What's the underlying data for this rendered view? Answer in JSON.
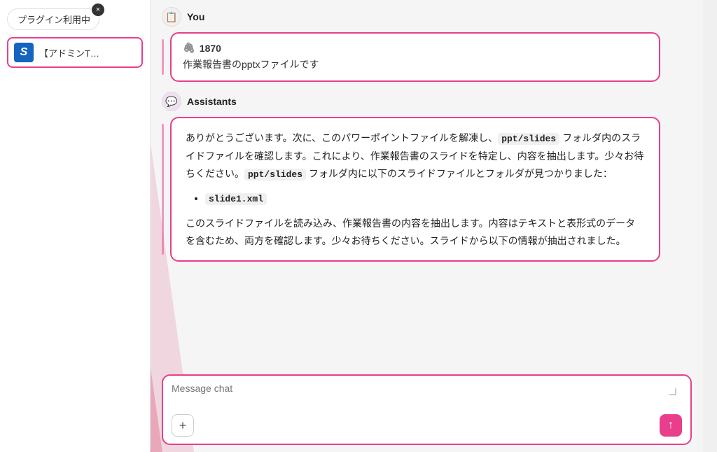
{
  "sidebar": {
    "plugin_label": "プラグイン利用中",
    "close_icon": "×",
    "item": {
      "icon_letter": "S",
      "label": "【アドミンT…"
    }
  },
  "you_section": {
    "sender": "You",
    "avatar_icon": "📋",
    "attachment_number": "1870",
    "clip_icon": "🖇",
    "message": "作業報告書のpptxファイルです"
  },
  "assistant_section": {
    "sender": "Assistants",
    "avatar_icon": "💬",
    "paragraph1": "ありがとうございます。次に、このパワーポイントファイルを解凍し、`ppt/slides` フォルダ内のスライドファイルを確認します。これにより、作業報告書のスライドを特定し、内容を抽出します。少々お待ちください。`ppt/slides` フォルダ内に以下のスライドファイルとフォルダが見つかりました：",
    "code_folder": "ppt/slides",
    "list_item": "`slide1.xml`",
    "paragraph2": "このスライドファイルを読み込み、作業報告書の内容を抽出します。内容はテキストと表形式のデータを含むため、両方を確認します。少々お待ちください。スライドから以下の情報が抽出されました。"
  },
  "input": {
    "placeholder": "Message chat",
    "add_label": "+",
    "send_icon": "↑"
  }
}
